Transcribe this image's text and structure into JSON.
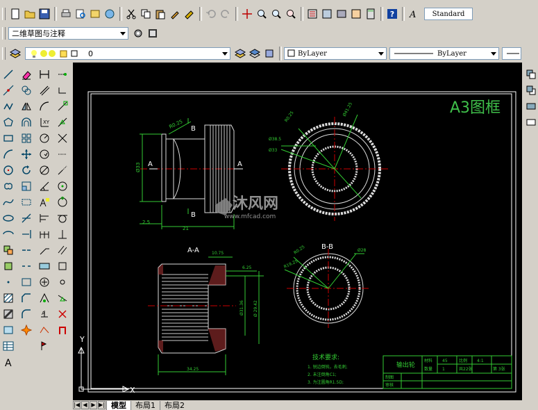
{
  "toolbar_top": {
    "style_box_value": "Standard"
  },
  "toolbar_workspace": {
    "workspace_value": "二维草图与注释"
  },
  "toolbar_layers": {
    "layer_value": "0",
    "color_value": "ByLayer",
    "linetype_value": "ByLayer"
  },
  "drawing": {
    "frame_title": "A3图框",
    "watermark_cn": "沐风网",
    "watermark_url": "www.mfcad.com",
    "view1": {
      "dim_d": "Ø33",
      "dim_2": "2.5",
      "dim_21": "21",
      "dim_top": "R0.25",
      "label_a_left": "A",
      "label_a_right": "A",
      "label_b_top": "B",
      "label_b_bottom": "B"
    },
    "view2": {
      "dim_1": "Ø38.5",
      "dim_2": "Ø33",
      "dim_3": "R0.25",
      "dim_4": "Ø41.25"
    },
    "section_a": {
      "title": "A-A",
      "dim_top": "10.75",
      "dim_right": "6.25",
      "dim_d1": "Ø31.36",
      "dim_d2": "Ø 29.42",
      "dim_bottom": "34.25"
    },
    "section_b": {
      "title": "B-B",
      "dim_1": "Ø28",
      "dim_2": "R0.25",
      "dim_3": "R19.25"
    },
    "notes": {
      "title": "技术要求:",
      "line1": "1. 锐边倒钝，去毛刺;",
      "line2": "2. 未注倒角C1;",
      "line3": "3. 为注圆角R1.5D;"
    },
    "titleblock": {
      "name": "输出轮",
      "material_label": "材料",
      "material_value": "45",
      "scale_label": "比例",
      "scale_value": "4:1",
      "qty_label": "数量",
      "qty_value": "1",
      "sheet_total": "共22张",
      "sheet_no": "第 3张",
      "drawn_label": "制图",
      "check_label": "审核"
    },
    "ucs_y": "Y",
    "ucs_x": "X"
  },
  "tabs": [
    "模型",
    "布局1",
    "布局2"
  ]
}
